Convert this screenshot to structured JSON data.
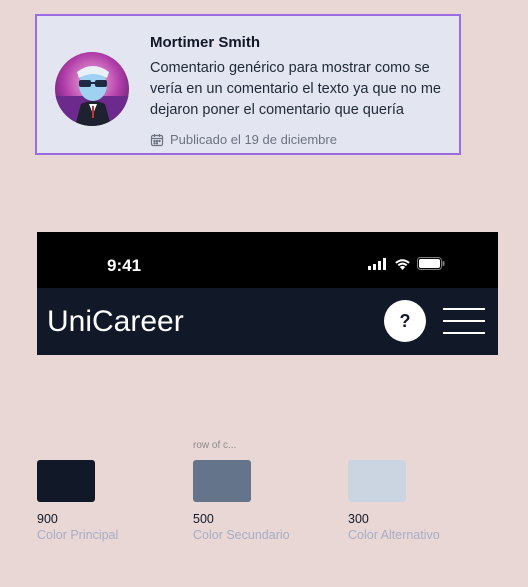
{
  "comment": {
    "author": "Mortimer Smith",
    "text": "Comentario genérico para mostrar como se vería en un comentario el texto ya que no me dejaron poner el comentario que quería",
    "published": "Publicado el 19 de diciembre",
    "avatar_icon": "avatar-illustration",
    "calendar_icon": "calendar-icon",
    "border_color": "#9b6be0"
  },
  "phone": {
    "time": "9:41",
    "app_title": "UniCareer",
    "help_label": "?",
    "icons": [
      "signal-icon",
      "wifi-icon",
      "battery-icon",
      "menu-icon"
    ]
  },
  "palette": {
    "row_label": "row of c...",
    "swatches": [
      {
        "number": "900",
        "name": "Color Principal",
        "color": "#111827"
      },
      {
        "number": "500",
        "name": "Color Secundario",
        "color": "#64748b"
      },
      {
        "number": "300",
        "name": "Color Alternativo",
        "color": "#cbd5e1"
      }
    ]
  }
}
